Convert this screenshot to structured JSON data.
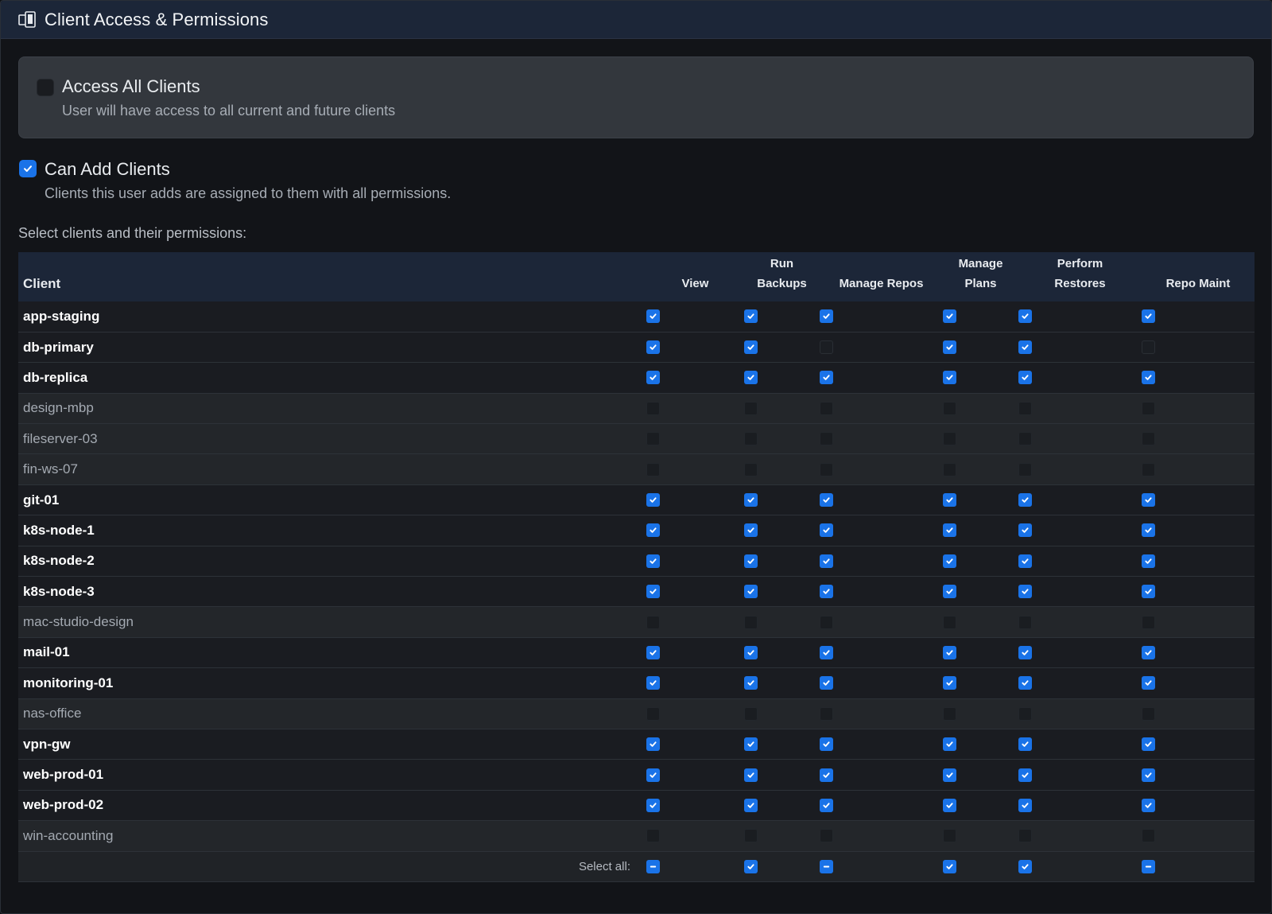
{
  "header": {
    "title": "Client Access & Permissions",
    "icon": "devices-icon"
  },
  "access_all": {
    "title": "Access All Clients",
    "description": "User will have access to all current and future clients",
    "checked": false
  },
  "can_add": {
    "title": "Can Add Clients",
    "description": "Clients this user adds are assigned to them with all permissions.",
    "checked": true
  },
  "select_label": "Select clients and their permissions:",
  "table": {
    "headers": {
      "client": "Client",
      "view": "View",
      "run_backups": "Run Backups",
      "manage_repos": "Manage Repos",
      "manage_plans": "Manage Plans",
      "perform_restores_line1": "Perform",
      "perform_restores_line2": "Restores",
      "repo_maint": "Repo Maint"
    },
    "rows": [
      {
        "name": "app-staging",
        "enabled": true,
        "perms": [
          true,
          true,
          true,
          true,
          true,
          true
        ]
      },
      {
        "name": "db-primary",
        "enabled": true,
        "perms": [
          true,
          true,
          false,
          true,
          true,
          false
        ]
      },
      {
        "name": "db-replica",
        "enabled": true,
        "perms": [
          true,
          true,
          true,
          true,
          true,
          true
        ]
      },
      {
        "name": "design-mbp",
        "enabled": false,
        "perms": [
          false,
          false,
          false,
          false,
          false,
          false
        ]
      },
      {
        "name": "fileserver-03",
        "enabled": false,
        "perms": [
          false,
          false,
          false,
          false,
          false,
          false
        ]
      },
      {
        "name": "fin-ws-07",
        "enabled": false,
        "perms": [
          false,
          false,
          false,
          false,
          false,
          false
        ]
      },
      {
        "name": "git-01",
        "enabled": true,
        "perms": [
          true,
          true,
          true,
          true,
          true,
          true
        ]
      },
      {
        "name": "k8s-node-1",
        "enabled": true,
        "perms": [
          true,
          true,
          true,
          true,
          true,
          true
        ]
      },
      {
        "name": "k8s-node-2",
        "enabled": true,
        "perms": [
          true,
          true,
          true,
          true,
          true,
          true
        ]
      },
      {
        "name": "k8s-node-3",
        "enabled": true,
        "perms": [
          true,
          true,
          true,
          true,
          true,
          true
        ]
      },
      {
        "name": "mac-studio-design",
        "enabled": false,
        "perms": [
          false,
          false,
          false,
          false,
          false,
          false
        ]
      },
      {
        "name": "mail-01",
        "enabled": true,
        "perms": [
          true,
          true,
          true,
          true,
          true,
          true
        ]
      },
      {
        "name": "monitoring-01",
        "enabled": true,
        "perms": [
          true,
          true,
          true,
          true,
          true,
          true
        ]
      },
      {
        "name": "nas-office",
        "enabled": false,
        "perms": [
          false,
          false,
          false,
          false,
          false,
          false
        ]
      },
      {
        "name": "vpn-gw",
        "enabled": true,
        "perms": [
          true,
          true,
          true,
          true,
          true,
          true
        ]
      },
      {
        "name": "web-prod-01",
        "enabled": true,
        "perms": [
          true,
          true,
          true,
          true,
          true,
          true
        ]
      },
      {
        "name": "web-prod-02",
        "enabled": true,
        "perms": [
          true,
          true,
          true,
          true,
          true,
          true
        ]
      },
      {
        "name": "win-accounting",
        "enabled": false,
        "perms": [
          false,
          false,
          false,
          false,
          false,
          false
        ]
      }
    ],
    "select_all_label": "Select all:",
    "select_all_states": [
      "indeterminate",
      "checked",
      "indeterminate",
      "checked",
      "checked",
      "indeterminate"
    ]
  },
  "colors": {
    "accent": "#1a73e8",
    "header_bg": "#1c2638"
  }
}
